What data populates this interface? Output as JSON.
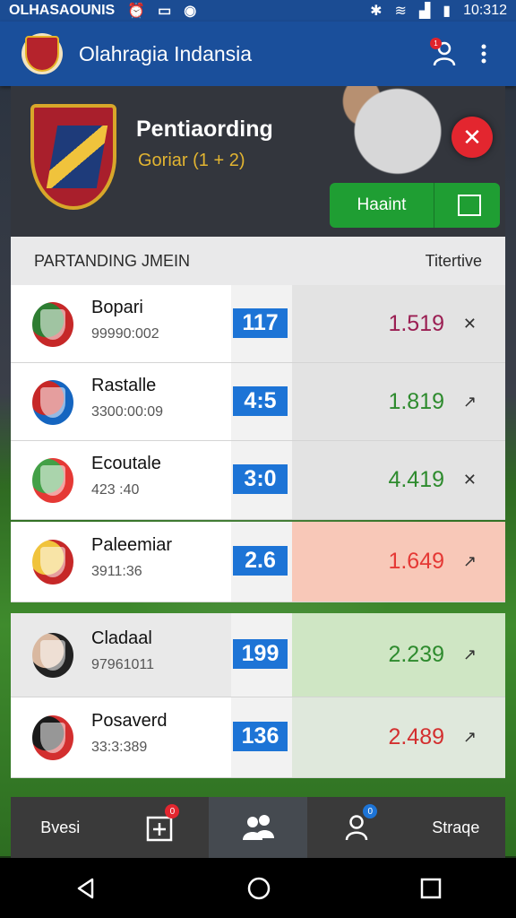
{
  "status_bar": {
    "left_text": "OLHASAOUNIS",
    "time": "10:312"
  },
  "app_bar": {
    "title": "Olahragia Indansia",
    "profile_badge": "1"
  },
  "hero": {
    "title": "Pentiaording",
    "subtitle": "Goriar (1 + 2)",
    "primary_button": "Haaint"
  },
  "list_header": {
    "left": "PARTANDING JMEIN",
    "right": "Titertive"
  },
  "rows": [
    {
      "name": "Bopari",
      "code": "99990:002",
      "score": "117",
      "odds": "1.519",
      "odds_color": "#9b1f53",
      "trend": "✕",
      "logo_a": "#2e7d32",
      "logo_b": "#c62828",
      "left_bg": "#ffffff",
      "right_bg": "#e3e3e3"
    },
    {
      "name": "Rastalle",
      "code": "3300:00:09",
      "score": "4:5",
      "odds": "1.819",
      "odds_color": "#2e8b2e",
      "trend": "↗",
      "logo_a": "#c62828",
      "logo_b": "#1565c0",
      "left_bg": "#ffffff",
      "right_bg": "#e3e3e3"
    },
    {
      "name": "Ecoutale",
      "code": "423 :40",
      "score": "3:0",
      "odds": "4.419",
      "odds_color": "#2e8b2e",
      "trend": "✕",
      "logo_a": "#43a047",
      "logo_b": "#e53935",
      "left_bg": "#ffffff",
      "right_bg": "#e3e3e3"
    },
    {
      "name": "Paleemiar",
      "code": "3911:36",
      "score": "2.6",
      "odds": "1.649",
      "odds_color": "#e53935",
      "trend": "↗",
      "logo_a": "#f0c33c",
      "logo_b": "#c62828",
      "left_bg": "#ffffff",
      "right_bg": "#f8c8b8"
    },
    {
      "name": "Cladaal",
      "code": "97961011",
      "score": "199",
      "odds": "2.239",
      "odds_color": "#2e8b2e",
      "trend": "↗",
      "logo_a": "#d9b8a0",
      "logo_b": "#222222",
      "left_bg": "#e9e9e9",
      "right_bg": "#cfe6c4"
    },
    {
      "name": "Posaverd",
      "code": "33:3:389",
      "score": "136",
      "odds": "2.489",
      "odds_color": "#d32f2f",
      "trend": "↗",
      "logo_a": "#1a1a1a",
      "logo_b": "#d32f2f",
      "left_bg": "#ffffff",
      "right_bg": "#dfe8dc"
    }
  ],
  "bottom_nav": {
    "tab1": "Bvesi",
    "tab2_badge": "0",
    "tab4_badge": "0",
    "tab5": "Straqe"
  }
}
